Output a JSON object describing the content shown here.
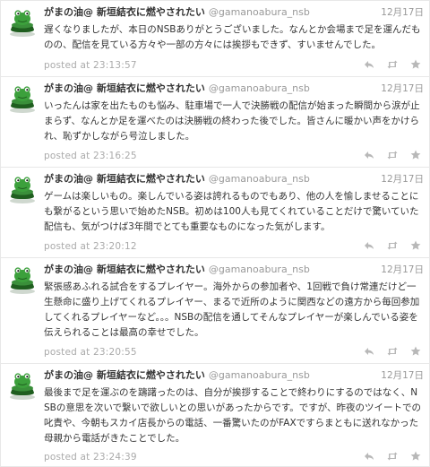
{
  "author": {
    "display_name": "がまの油@ 新垣結衣に燃やされたい",
    "screen_name": "@gamanoabura_nsb"
  },
  "tweets": [
    {
      "date": "12月17日",
      "text": "遅くなりましたが、本日のNSBありがとうございました。なんとか会場まで足を運んだものの、配信を見ている方々や一部の方々には挨拶もできず、すいませんでした。",
      "posted_at": "posted at 23:13:57"
    },
    {
      "date": "12月17日",
      "text": "いったんは家を出たものも悩み、駐車場で一人で決勝戦の配信が始まった瞬間から涙が止まらず、なんとか足を運べたのは決勝戦の終わった後でした。皆さんに暖かい声をかけられ、恥ずかしながら号泣しました。",
      "posted_at": "posted at 23:16:25"
    },
    {
      "date": "12月17日",
      "text": "ゲームは楽しいもの。楽しんでいる姿は誇れるものでもあり、他の人を愉しませることにも繋がるという思いで始めたNSB。初めは100人も見てくれていることだけで驚いていた配信も、気がつけば3年間でとても重要なものになった気がします。",
      "posted_at": "posted at 23:20:12"
    },
    {
      "date": "12月17日",
      "text": "緊張感あふれる試合をするプレイヤー。海外からの参加者や、1回戦で負け常連だけど一生懸命に盛り上げてくれるプレイヤー、まるで近所のように関西などの遠方から毎回参加してくれるプレイヤーなど。。。NSBの配信を通してそんなプレイヤーが楽しんでいる姿を伝えられることは最高の幸せでした。",
      "posted_at": "posted at 23:20:55"
    },
    {
      "date": "12月17日",
      "text": "最後まで足を運ぶのを躊躇ったのは、自分が挨拶することで終わりにするのではなく、NSBの意思を次いで繋いで欲しいとの思いがあったからです。ですが、昨夜のツイートでの叱責や、今朝もスカイ店長からの電話、一番驚いたのがFAXですらまともに送れなかった母親から電話がきたことでした。",
      "posted_at": "posted at 23:24:39"
    }
  ],
  "icons": {
    "avatar": "frog-avatar-icon",
    "reply": "reply-icon",
    "retweet": "retweet-icon",
    "favorite": "star-icon"
  },
  "colors": {
    "meta_text": "#aaaaaa",
    "screen_name": "#999999",
    "avatar_green": "#2e8b2e",
    "avatar_dark": "#1f5e1f"
  }
}
